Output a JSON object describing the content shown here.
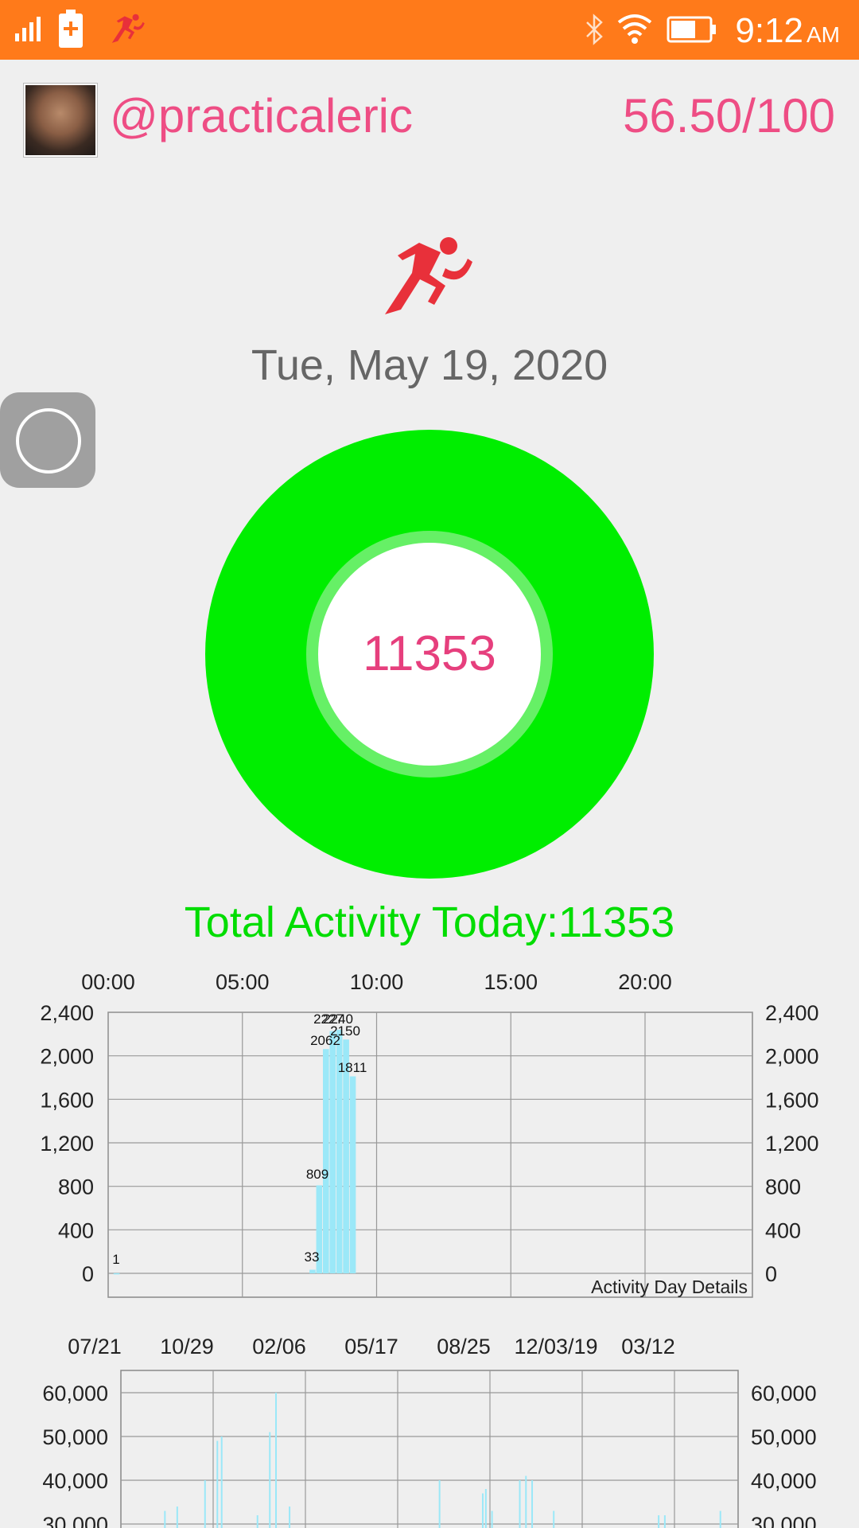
{
  "status_bar": {
    "time": "9:12",
    "ampm": "AM",
    "icons": [
      "signal-icon",
      "battery-charging-icon",
      "app-runner-icon",
      "bluetooth-icon",
      "wifi-icon",
      "battery-icon"
    ],
    "background": "#ff7a1a"
  },
  "header": {
    "username": "@practicaleric",
    "score": "56.50/100"
  },
  "activity": {
    "icon": "runner-icon",
    "date": "Tue, May 19, 2020",
    "steps": "11353",
    "total_label": "Total Activity Today:11353",
    "ring_color": "#00ee00"
  },
  "chart_data": [
    {
      "type": "bar",
      "x_tick_labels": [
        "00:00",
        "05:00",
        "10:00",
        "15:00",
        "20:00"
      ],
      "y_tick_labels": [
        "2,400",
        "2,000",
        "1,600",
        "1,200",
        "800",
        "400",
        "0"
      ],
      "ylim": [
        0,
        2400
      ],
      "grid": true,
      "description_label": "Activity Day Details",
      "bar_color": "#9be8f8",
      "bars": [
        {
          "hour": 0.2,
          "value": 1,
          "label": "1"
        },
        {
          "hour": 7.5,
          "value": 33,
          "label": "33"
        },
        {
          "hour": 7.75,
          "value": 809,
          "label": "809"
        },
        {
          "hour": 8.0,
          "value": 2062,
          "label": "2062"
        },
        {
          "hour": 8.25,
          "value": 2227,
          "label": "2227"
        },
        {
          "hour": 8.5,
          "value": 2240,
          "label": "2240"
        },
        {
          "hour": 8.75,
          "value": 2150,
          "label": "2150"
        },
        {
          "hour": 9.0,
          "value": 1811,
          "label": "1811"
        }
      ]
    },
    {
      "type": "bar",
      "x_tick_labels": [
        "07/21",
        "10/29",
        "02/06",
        "05/17",
        "08/25",
        "12/03/19",
        "03/12"
      ],
      "y_tick_labels": [
        "60,000",
        "50,000",
        "40,000",
        "30,000"
      ],
      "ylim": [
        0,
        60000
      ],
      "grid": true,
      "bar_color": "#9be8f8",
      "bars": [
        {
          "pos": 0.07,
          "value": 33000
        },
        {
          "pos": 0.09,
          "value": 34000
        },
        {
          "pos": 0.135,
          "value": 40000
        },
        {
          "pos": 0.155,
          "value": 49000
        },
        {
          "pos": 0.162,
          "value": 50000
        },
        {
          "pos": 0.22,
          "value": 32000
        },
        {
          "pos": 0.24,
          "value": 51000
        },
        {
          "pos": 0.25,
          "value": 60000
        },
        {
          "pos": 0.272,
          "value": 34000
        },
        {
          "pos": 0.515,
          "value": 40000
        },
        {
          "pos": 0.585,
          "value": 37000
        },
        {
          "pos": 0.59,
          "value": 38000
        },
        {
          "pos": 0.6,
          "value": 33000
        },
        {
          "pos": 0.645,
          "value": 40000
        },
        {
          "pos": 0.655,
          "value": 41000
        },
        {
          "pos": 0.665,
          "value": 40000
        },
        {
          "pos": 0.7,
          "value": 33000
        },
        {
          "pos": 0.87,
          "value": 32000
        },
        {
          "pos": 0.88,
          "value": 32000
        },
        {
          "pos": 0.97,
          "value": 33000
        }
      ]
    }
  ]
}
